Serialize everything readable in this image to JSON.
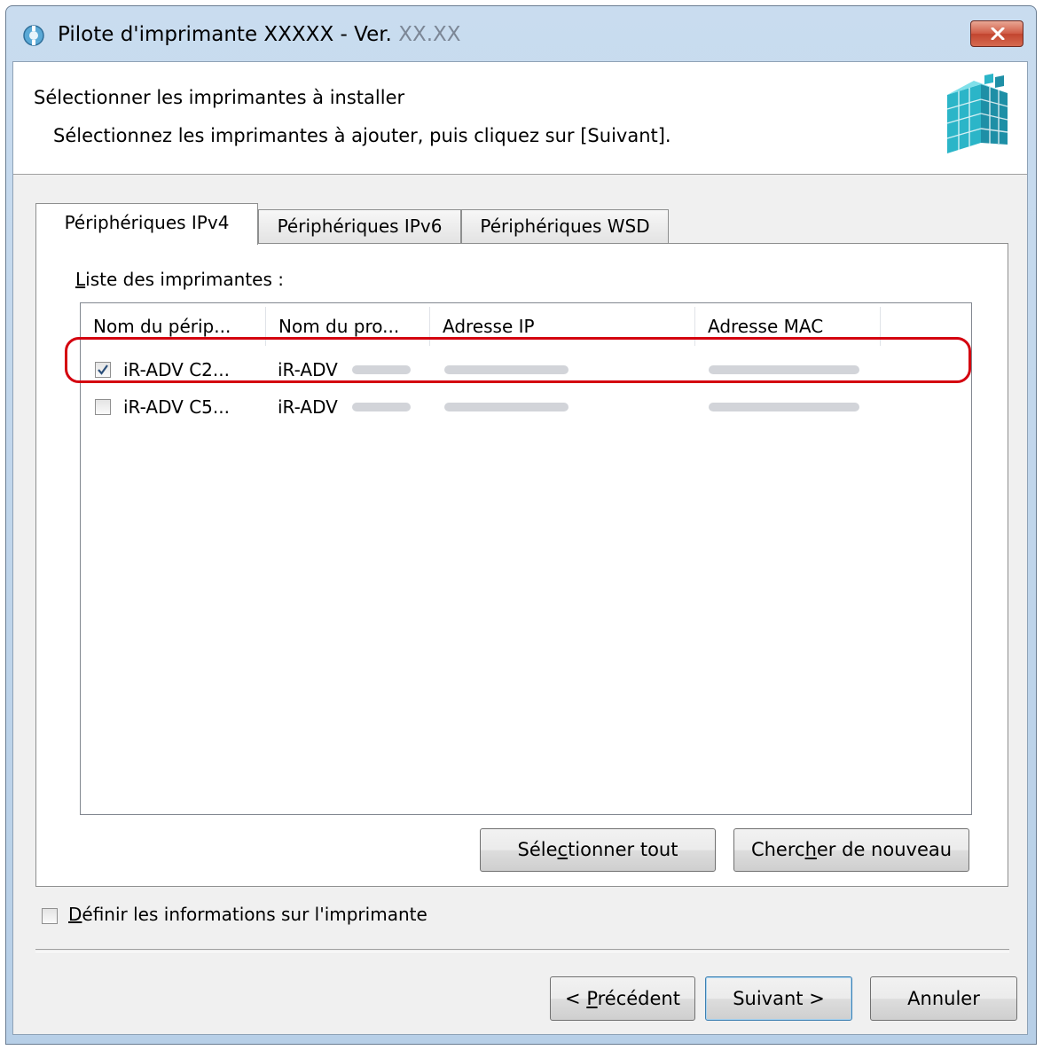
{
  "window": {
    "title_main": "Pilote d'imprimante XXXXX - Ver. ",
    "title_version": "XX.XX",
    "close_icon": "close-icon"
  },
  "header": {
    "title": "Sélectionner les imprimantes à installer",
    "subtitle": "Sélectionnez les imprimantes à ajouter, puis cliquez sur [Suivant].",
    "icon": "printer-cube-icon"
  },
  "tabs": [
    {
      "label": "Périphériques IPv4",
      "active": true
    },
    {
      "label": "Périphériques IPv6",
      "active": false
    },
    {
      "label": "Périphériques WSD",
      "active": false
    }
  ],
  "printer_list": {
    "label_first": "L",
    "label_rest": "iste des imprimantes :",
    "columns": [
      "Nom du périp...",
      "Nom du pro...",
      "Adresse IP",
      "Adresse MAC"
    ],
    "rows": [
      {
        "checked": true,
        "device_name": "iR-ADV C2...",
        "product_name": "iR-ADV",
        "ip": "",
        "mac": ""
      },
      {
        "checked": false,
        "device_name": "iR-ADV C5...",
        "product_name": "iR-ADV",
        "ip": "",
        "mac": ""
      }
    ]
  },
  "buttons": {
    "select_all_pre": "Séle",
    "select_all_key": "c",
    "select_all_post": "tionner tout",
    "search_again_pre": "Cherc",
    "search_again_key": "h",
    "search_again_post": "er de nouveau",
    "previous_pre": "< ",
    "previous_key": "P",
    "previous_post": "récédent",
    "next": "Suivant >",
    "cancel": "Annuler"
  },
  "options": {
    "define_info_key": "D",
    "define_info_rest": "éfinir les informations sur l'imprimante",
    "define_info_checked": false
  },
  "colors": {
    "highlight": "#d4000f",
    "titlebar": "#c9dcef",
    "close_button": "#c2452f"
  }
}
